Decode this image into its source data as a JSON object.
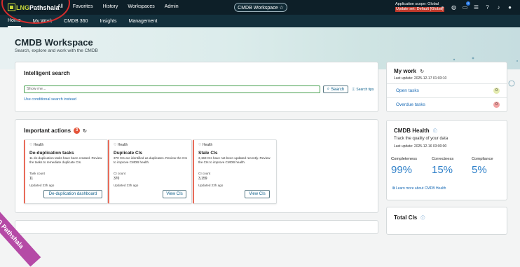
{
  "brand": {
    "logo_text_1": "LNG ",
    "logo_text_2": "Pathshala"
  },
  "topnav": {
    "items": [
      "All",
      "Favorites",
      "History",
      "Workspaces",
      "Admin"
    ]
  },
  "workspace_pill": {
    "label": "CMDB Workspace ☆"
  },
  "scope": {
    "line1": "Application scope: Global",
    "line2": "Update set: Default [Global]"
  },
  "top_icons": [
    "search-icon",
    "globe-icon",
    "chat-icon",
    "list-icon",
    "help-icon",
    "bell-icon",
    "avatar"
  ],
  "notification_count": "1",
  "subnav": {
    "items": [
      "Home",
      "My Work",
      "CMDB 360",
      "Insights",
      "Management"
    ],
    "active": "Home"
  },
  "hero": {
    "title": "CMDB Workspace",
    "subtitle": "Search, explore and work with the CMDB"
  },
  "search": {
    "title": "Intelligent search",
    "placeholder": "Show me...",
    "button": "Search",
    "tips": "Search tips",
    "conditional": "Use conditional search instead"
  },
  "actions": {
    "title": "Important actions",
    "count": "3",
    "cards": [
      {
        "tag": "Health",
        "title": "De-duplication tasks",
        "desc": "11 de-duplication tasks have been created. Review the tasks to remediate duplicate CIs.",
        "count_label": "Task count",
        "count": "11",
        "updated": "Updated 23h ago",
        "button": "De-duplication dashboard"
      },
      {
        "tag": "Health",
        "title": "Duplicate CIs",
        "desc": "370 CIs are identified as duplicates. Review the CIs to improve CMDB health.",
        "count_label": "CI count",
        "count": "370",
        "updated": "Updated 23h ago",
        "button": "View CIs"
      },
      {
        "tag": "Health",
        "title": "Stale CIs",
        "desc": "3,159 CIs have not been updated recently. Review the CIs to improve CMDB health.",
        "count_label": "CI count",
        "count": "3,159",
        "updated": "Updated 23h ago",
        "button": "View CIs"
      }
    ]
  },
  "my_work": {
    "title": "My work",
    "updated": "Last update: 2025-12-17 01:03:10",
    "rows": [
      {
        "label": "Open tasks",
        "count": "0",
        "color": "#e4ebb0"
      },
      {
        "label": "Overdue tasks",
        "count": "0",
        "color": "#f2a3a3"
      }
    ]
  },
  "cmdb_health": {
    "title": "CMDB Health",
    "subtitle": "Track the quality of your data",
    "updated": "Last update: 2025-12-16 03:00:00",
    "metrics": [
      {
        "label": "Completeness",
        "value": "99%"
      },
      {
        "label": "Correctness",
        "value": "15%"
      },
      {
        "label": "Compliance",
        "value": "5%"
      }
    ],
    "learn_more": "Learn more about CMDB Health"
  },
  "total_cis": {
    "title": "Total CIs"
  },
  "watermark": {
    "text": "LNG Pathshala"
  }
}
